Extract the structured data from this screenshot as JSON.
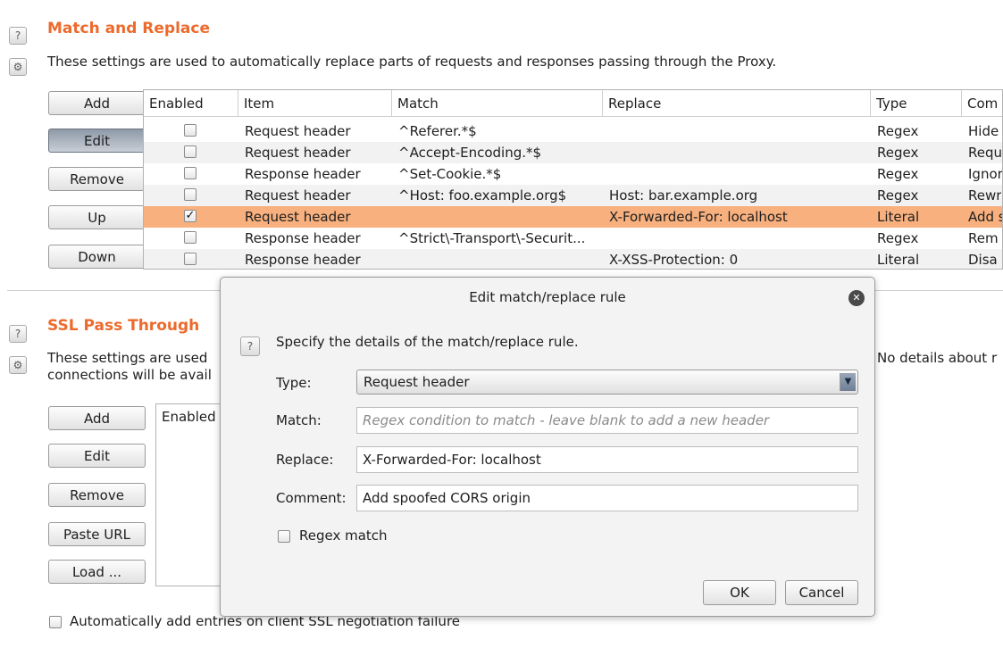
{
  "match_replace": {
    "title": "Match and Replace",
    "description": "These settings are used to automatically replace parts of requests and responses passing through the Proxy.",
    "buttons": {
      "add": "Add",
      "edit": "Edit",
      "remove": "Remove",
      "up": "Up",
      "down": "Down"
    },
    "columns": [
      "Enabled",
      "Item",
      "Match",
      "Replace",
      "Type",
      "Com"
    ],
    "rows": [
      {
        "enabled": false,
        "item": "Request header",
        "match": "^Referer.*$",
        "replace": "",
        "type": "Regex",
        "comment": "Hide"
      },
      {
        "enabled": false,
        "item": "Request header",
        "match": "^Accept-Encoding.*$",
        "replace": "",
        "type": "Regex",
        "comment": "Requ"
      },
      {
        "enabled": false,
        "item": "Response header",
        "match": "^Set-Cookie.*$",
        "replace": "",
        "type": "Regex",
        "comment": "Ignor"
      },
      {
        "enabled": false,
        "item": "Request header",
        "match": "^Host: foo.example.org$",
        "replace": "Host: bar.example.org",
        "type": "Regex",
        "comment": "Rewr"
      },
      {
        "enabled": true,
        "item": "Request header",
        "match": "",
        "replace": "X-Forwarded-For: localhost",
        "type": "Literal",
        "comment": "Add s"
      },
      {
        "enabled": false,
        "item": "Response header",
        "match": "^Strict\\-Transport\\-Securit...",
        "replace": "",
        "type": "Regex",
        "comment": "Rem"
      },
      {
        "enabled": false,
        "item": "Response header",
        "match": "",
        "replace": "X-XSS-Protection: 0",
        "type": "Literal",
        "comment": "Disa"
      }
    ]
  },
  "ssl": {
    "title": "SSL Pass Through",
    "desc_line1": "These settings are used",
    "desc_line2": "connections will be avail",
    "desc_right": "No details about r",
    "buttons": {
      "add": "Add",
      "edit": "Edit",
      "remove": "Remove",
      "paste_url": "Paste URL",
      "load": "Load ..."
    },
    "column_enabled": "Enabled",
    "auto_add": "Automatically add entries on client SSL negotiation failure"
  },
  "dialog": {
    "title": "Edit match/replace rule",
    "instruction": "Specify the details of the match/replace rule.",
    "type_label": "Type:",
    "type_value": "Request header",
    "match_label": "Match:",
    "match_placeholder": "Regex condition to match - leave blank to add a new header",
    "replace_label": "Replace:",
    "replace_value": "X-Forwarded-For: localhost",
    "comment_label": "Comment:",
    "comment_value": "Add spoofed CORS origin",
    "regex_label": "Regex match",
    "ok": "OK",
    "cancel": "Cancel"
  },
  "colors": {
    "accent": "#ec6a2c",
    "selected_row": "#f7b07e"
  }
}
